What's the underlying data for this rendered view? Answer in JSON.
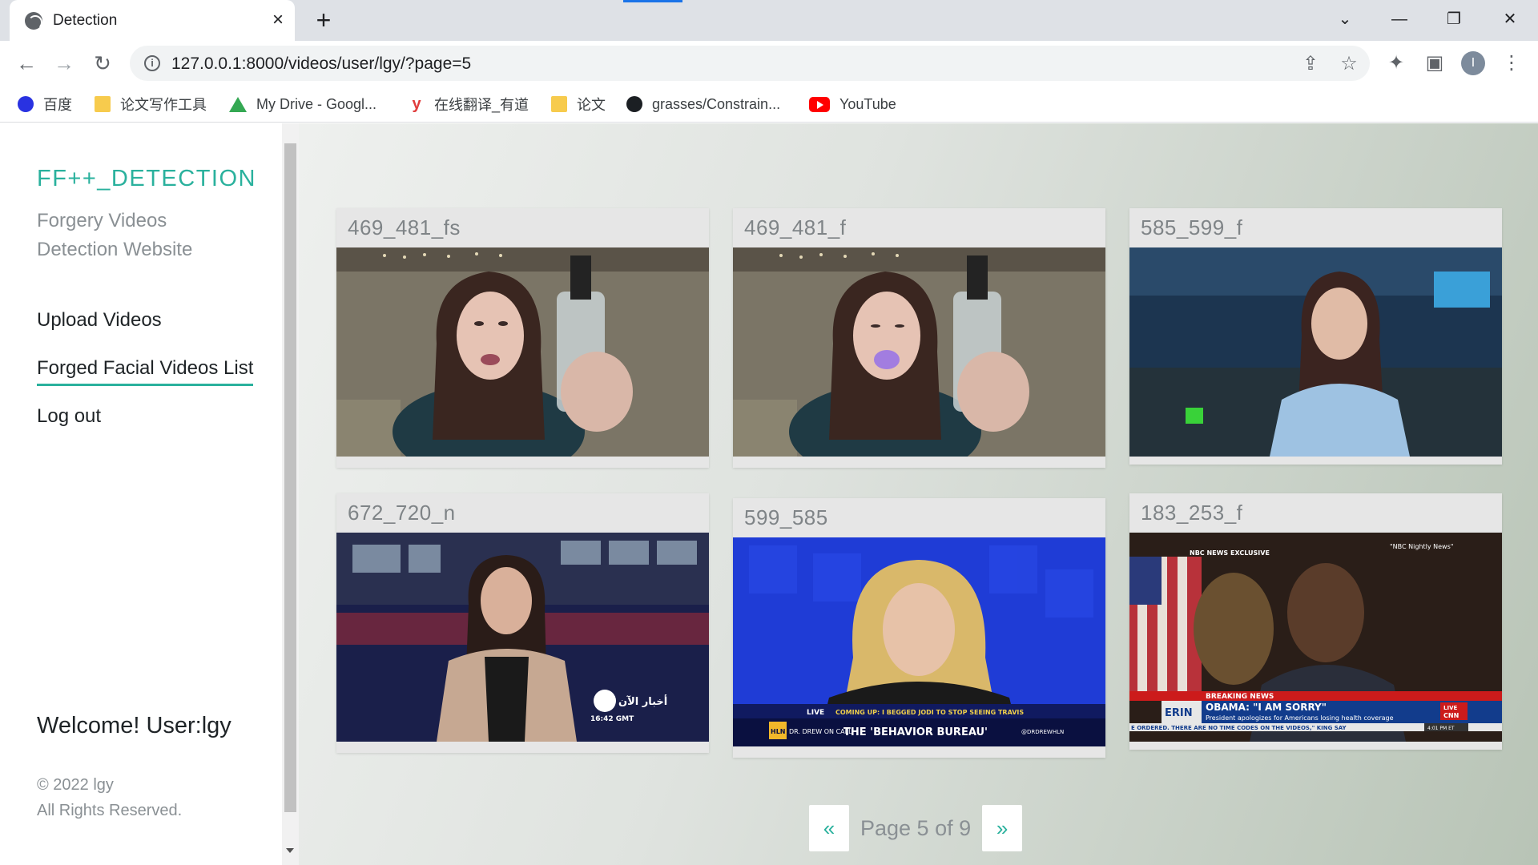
{
  "browser": {
    "tab_title": "Detection",
    "url": "127.0.0.1:8000/videos/user/lgy/?page=5",
    "bookmarks": [
      "百度",
      "论文写作工具",
      "My Drive - Googl...",
      "在线翻译_有道",
      "论文",
      "grasses/Constrain...",
      "YouTube"
    ],
    "profile_initial": "I"
  },
  "sidebar": {
    "brand": "FF++_DETECTION",
    "tagline": "Forgery Videos Detection Website",
    "nav": [
      "Upload Videos",
      "Forged Facial Videos List",
      "Log out"
    ],
    "welcome": "Welcome! User:lgy",
    "copyright": "© 2022 lgy",
    "rights": "All Rights Reserved."
  },
  "videos": [
    {
      "title": "469_481_fs"
    },
    {
      "title": "469_481_f"
    },
    {
      "title": "585_599_f"
    },
    {
      "title": "672_720_n"
    },
    {
      "title": "599_585"
    },
    {
      "title": "183_253_f"
    }
  ],
  "thumb_captions": {
    "v4_logo": "أخبار الآن",
    "v4_time": "16:42 GMT",
    "v5_live": "LIVE",
    "v5_coming": "COMING UP: I BEGGED JODI TO STOP SEEING TRAVIS",
    "v5_show": "DR. DREW ON CALL",
    "v5_headline": "THE 'BEHAVIOR BUREAU'",
    "v5_handle": "@DRDREWHLN",
    "v5_network": "HLN",
    "v6_nbc": "NBC NEWS EXCLUSIVE",
    "v6_nightly": "\"NBC Nightly News\"",
    "v6_breaking": "BREAKING NEWS",
    "v6_headline": "OBAMA: \"I AM SORRY\"",
    "v6_sub": "President apologizes for Americans losing health coverage",
    "v6_ticker": "E ORDERED. THERE ARE NO TIME CODES ON THE VIDEOS,\" KING SAY",
    "v6_show": "ERIN",
    "v6_live": "LIVE",
    "v6_network": "CNN",
    "v6_time": "4:01 PM ET"
  },
  "pagination": {
    "prev": "«",
    "label": "Page 5 of 9",
    "next": "»",
    "current_page": 5,
    "total_pages": 9
  },
  "colors": {
    "accent": "#2ab19d",
    "text_muted": "#8a9094"
  }
}
